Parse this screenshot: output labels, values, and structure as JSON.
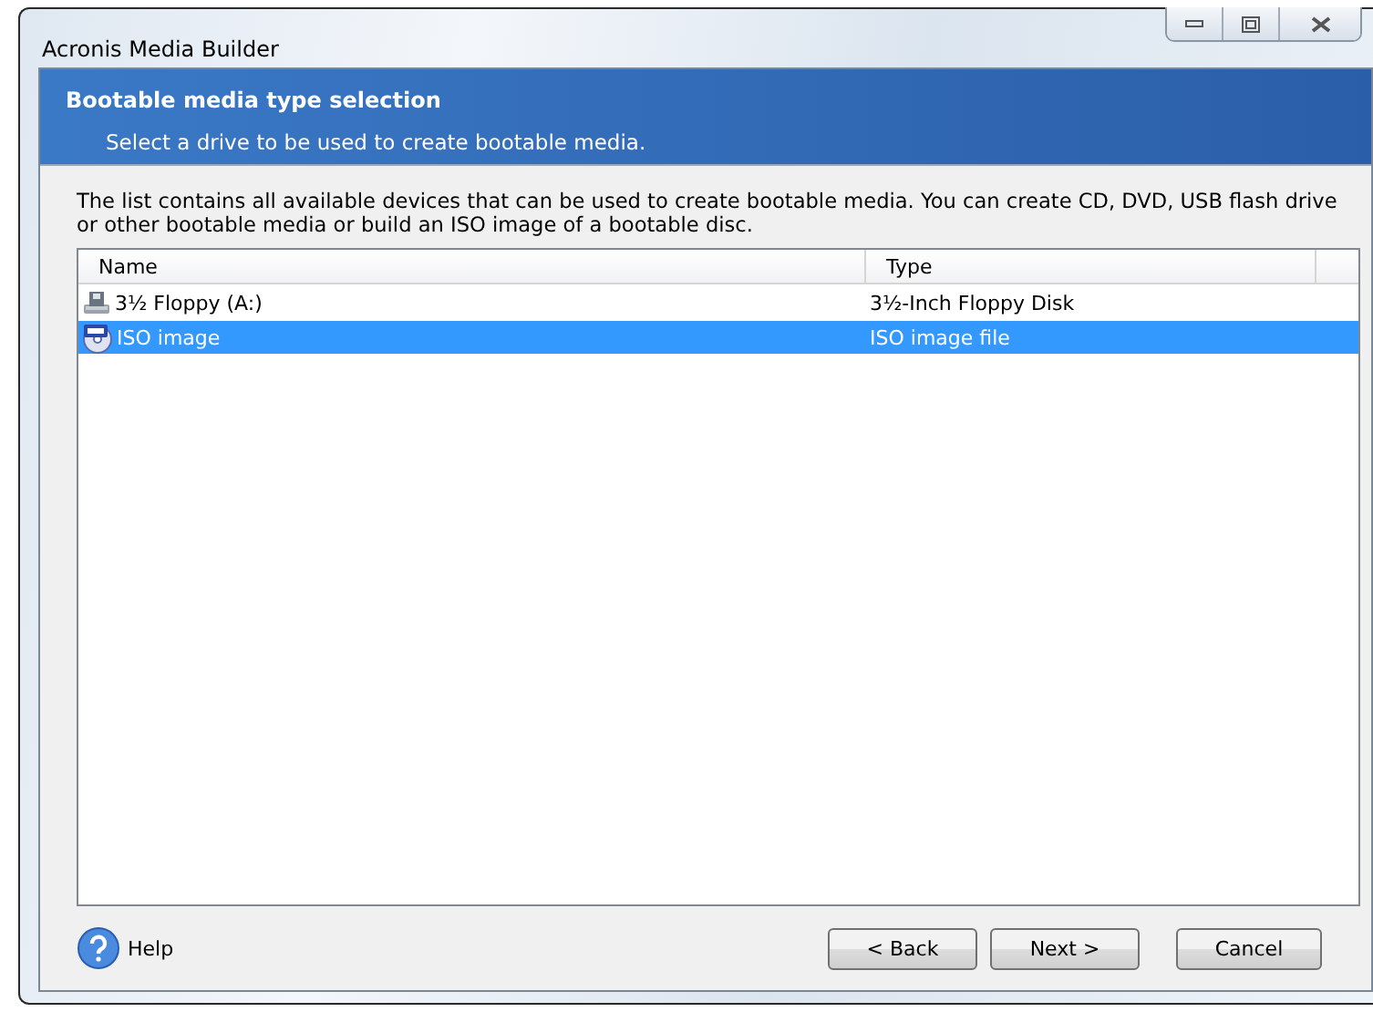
{
  "window": {
    "title": "Acronis Media Builder"
  },
  "header": {
    "title": "Bootable media type selection",
    "subtitle": "Select a drive to be used to create bootable media."
  },
  "description": "The list contains all available devices that can be used to create bootable media. You can create CD, DVD, USB flash drive or other bootable media or build an ISO image of a bootable disc.",
  "table": {
    "columns": [
      "Name",
      "Type"
    ],
    "rows": [
      {
        "kind": "floppy",
        "name": "3½ Floppy (A:)",
        "type": "3½-Inch Floppy Disk",
        "selected": false
      },
      {
        "kind": "iso",
        "name": "ISO image",
        "type": "ISO image file",
        "selected": true
      }
    ]
  },
  "help": "Help",
  "buttons": [
    "< Back",
    "Next >",
    "Cancel"
  ]
}
